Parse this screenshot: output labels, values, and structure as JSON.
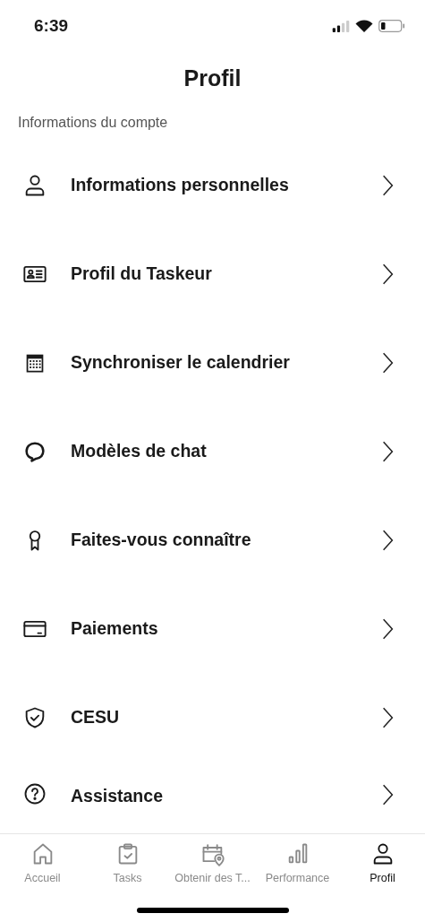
{
  "status_bar": {
    "time": "6:39"
  },
  "title": "Profil",
  "section": "Informations du compte",
  "items": [
    {
      "kind": "person",
      "label": "Informations personnelles"
    },
    {
      "kind": "id-card",
      "label": "Profil du Taskeur"
    },
    {
      "kind": "calendar",
      "label": "Synchroniser le calendrier"
    },
    {
      "kind": "chat",
      "label": "Modèles de chat"
    },
    {
      "kind": "award",
      "label": "Faites-vous connaître"
    },
    {
      "kind": "card",
      "label": "Paiements"
    },
    {
      "kind": "shield",
      "label": "CESU"
    },
    {
      "kind": "help",
      "label": "Assistance"
    }
  ],
  "tabs": [
    {
      "kind": "home",
      "label": "Accueil",
      "selected": false
    },
    {
      "kind": "clipboard",
      "label": "Tasks",
      "selected": false
    },
    {
      "kind": "calendar-pin",
      "label": "Obtenir des T...",
      "selected": false
    },
    {
      "kind": "bars",
      "label": "Performance",
      "selected": false
    },
    {
      "kind": "person",
      "label": "Profil",
      "selected": true
    }
  ]
}
